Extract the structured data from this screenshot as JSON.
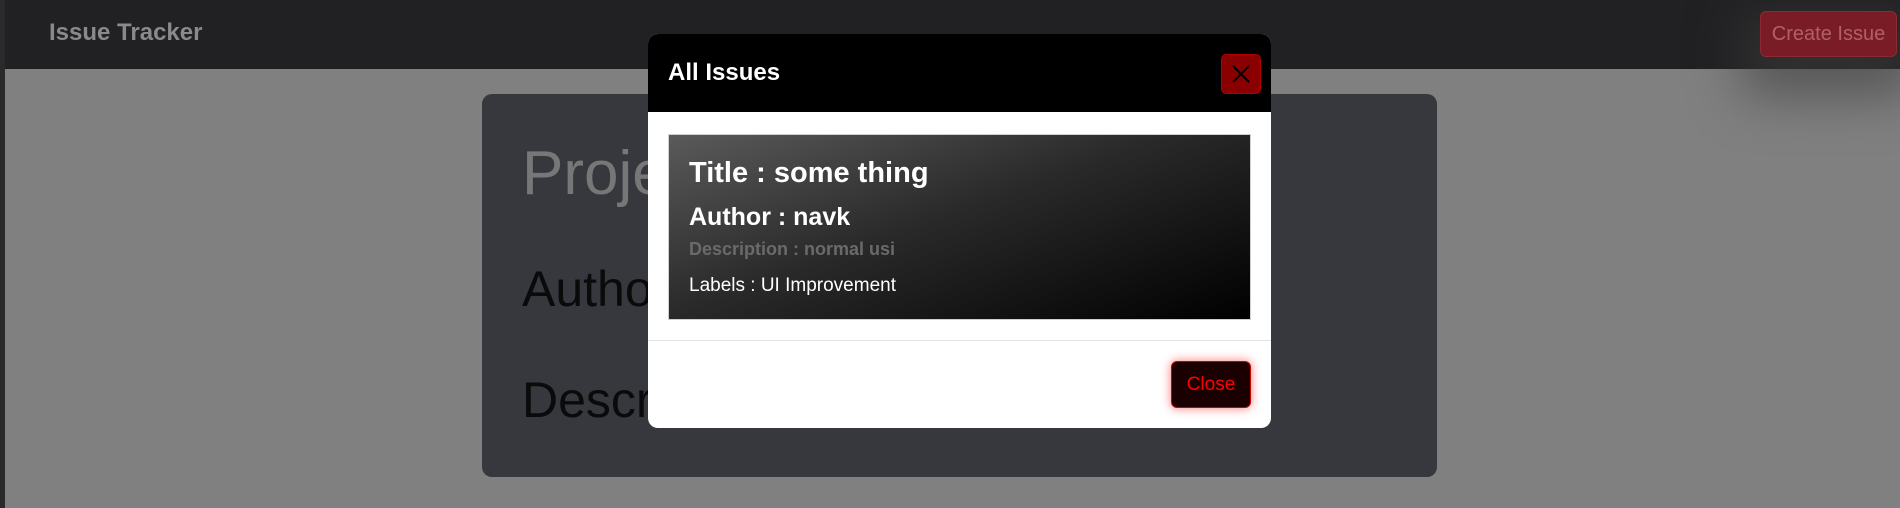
{
  "navbar": {
    "brand": "Issue Tracker",
    "create_button": "Create Issue"
  },
  "project": {
    "title_partial": "Proje",
    "author_partial": "Autho",
    "description_partial": "Descri"
  },
  "modal": {
    "title": "All Issues",
    "close_icon": "close-icon",
    "issue": {
      "title": "Title : some thing",
      "author": "Author : navk",
      "description": "Description : normal usi",
      "labels": "Labels : UI Improvement"
    },
    "close_button": "Close"
  },
  "colors": {
    "header": "#000000",
    "accent_red": "#ff0000",
    "close_icon_bg": "#8a0000"
  }
}
